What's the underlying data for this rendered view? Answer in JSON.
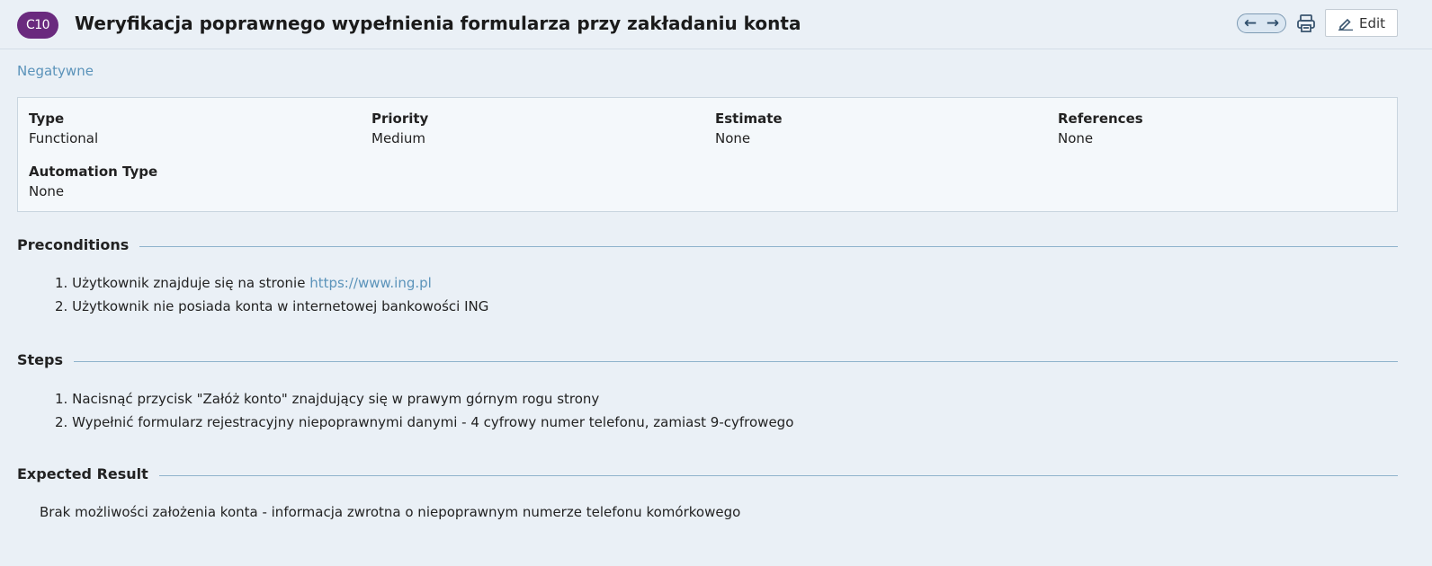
{
  "header": {
    "case_id": "C10",
    "title": "Weryfikacja poprawnego wypełnienia formularza przy zakładaniu konta",
    "prev_icon": "arrow-left-icon",
    "next_icon": "arrow-right-icon",
    "print_icon": "printer-icon",
    "edit_icon": "pencil-icon",
    "edit_label": "Edit"
  },
  "section_label": "Negatywne",
  "fields": {
    "type": {
      "label": "Type",
      "value": "Functional"
    },
    "priority": {
      "label": "Priority",
      "value": "Medium"
    },
    "estimate": {
      "label": "Estimate",
      "value": "None"
    },
    "references": {
      "label": "References",
      "value": "None"
    },
    "automation": {
      "label": "Automation Type",
      "value": "None"
    }
  },
  "preconditions": {
    "heading": "Preconditions",
    "items": [
      {
        "num": "1.",
        "text": "Użytkownik znajduje się na stronie ",
        "link": "https://www.ing.pl"
      },
      {
        "num": "2.",
        "text": "Użytkownik nie posiada konta w internetowej bankowości ING"
      }
    ]
  },
  "steps": {
    "heading": "Steps",
    "items": [
      {
        "num": "1.",
        "text": "Nacisnąć przycisk \"Załóż konto\" znajdujący się w prawym górnym rogu strony"
      },
      {
        "num": "2.",
        "text": "Wypełnić formularz rejestracyjny niepoprawnymi danymi - 4 cyfrowy numer telefonu, zamiast 9-cyfrowego"
      }
    ]
  },
  "expected": {
    "heading": "Expected Result",
    "text": "Brak możliwości założenia konta - informacja zwrotna o niepoprawnym numerze telefonu komórkowego"
  },
  "colors": {
    "badge": "#6a2a7e",
    "link": "#5b93ba",
    "background": "#eaf0f6"
  }
}
